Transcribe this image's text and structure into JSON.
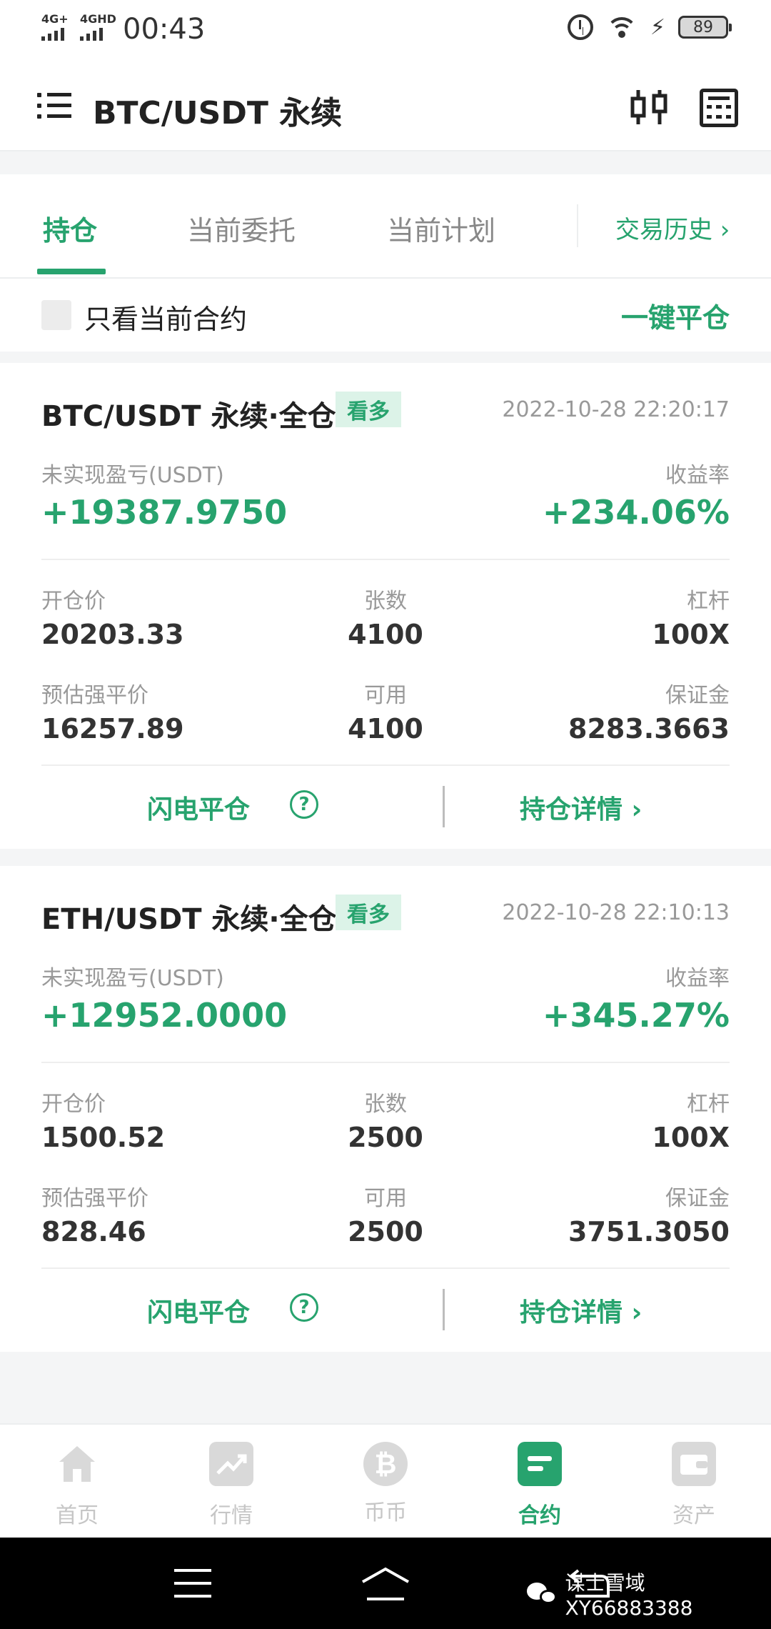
{
  "status_bar": {
    "network_1": "4G+",
    "network_2": "4GHD",
    "time": "00:43",
    "battery": "89"
  },
  "header": {
    "title": "BTC/USDT 永续"
  },
  "tabs": {
    "items": [
      {
        "label": "持仓",
        "active": true
      },
      {
        "label": "当前委托",
        "active": false
      },
      {
        "label": "当前计划",
        "active": false
      }
    ],
    "history": "交易历史 ›"
  },
  "filter": {
    "checkbox_label": "只看当前合约",
    "checked": false,
    "close_all": "一键平仓"
  },
  "positions": [
    {
      "title": "BTC/USDT 永续·全仓",
      "side": "看多",
      "time": "2022-10-28 22:20:17",
      "pnl_label": "未实现盈亏(USDT)",
      "pnl": "+19387.9750",
      "roe_label": "收益率",
      "roe": "+234.06%",
      "entry_label": "开仓价",
      "entry": "20203.33",
      "size_label": "张数",
      "size": "4100",
      "leverage_label": "杠杆",
      "leverage": "100X",
      "liq_label": "预估强平价",
      "liq": "16257.89",
      "avail_label": "可用",
      "avail": "4100",
      "margin_label": "保证金",
      "margin": "8283.3663",
      "flash_close": "闪电平仓",
      "details": "持仓详情 ›"
    },
    {
      "title": "ETH/USDT 永续·全仓",
      "side": "看多",
      "time": "2022-10-28 22:10:13",
      "pnl_label": "未实现盈亏(USDT)",
      "pnl": "+12952.0000",
      "roe_label": "收益率",
      "roe": "+345.27%",
      "entry_label": "开仓价",
      "entry": "1500.52",
      "size_label": "张数",
      "size": "2500",
      "leverage_label": "杠杆",
      "leverage": "100X",
      "liq_label": "预估强平价",
      "liq": "828.46",
      "avail_label": "可用",
      "avail": "2500",
      "margin_label": "保证金",
      "margin": "3751.3050",
      "flash_close": "闪电平仓",
      "details": "持仓详情 ›"
    }
  ],
  "bottom_nav": [
    {
      "label": "首页",
      "icon": "home-icon",
      "active": false
    },
    {
      "label": "行情",
      "icon": "chart-icon",
      "active": false
    },
    {
      "label": "币币",
      "icon": "bitcoin-icon",
      "active": false
    },
    {
      "label": "合约",
      "icon": "contract-icon",
      "active": true
    },
    {
      "label": "资产",
      "icon": "wallet-icon",
      "active": false
    }
  ],
  "watermark": "谋士雪域XY66883388",
  "colors": {
    "accent": "#27a36e",
    "badge_bg": "#dcf3e8"
  }
}
